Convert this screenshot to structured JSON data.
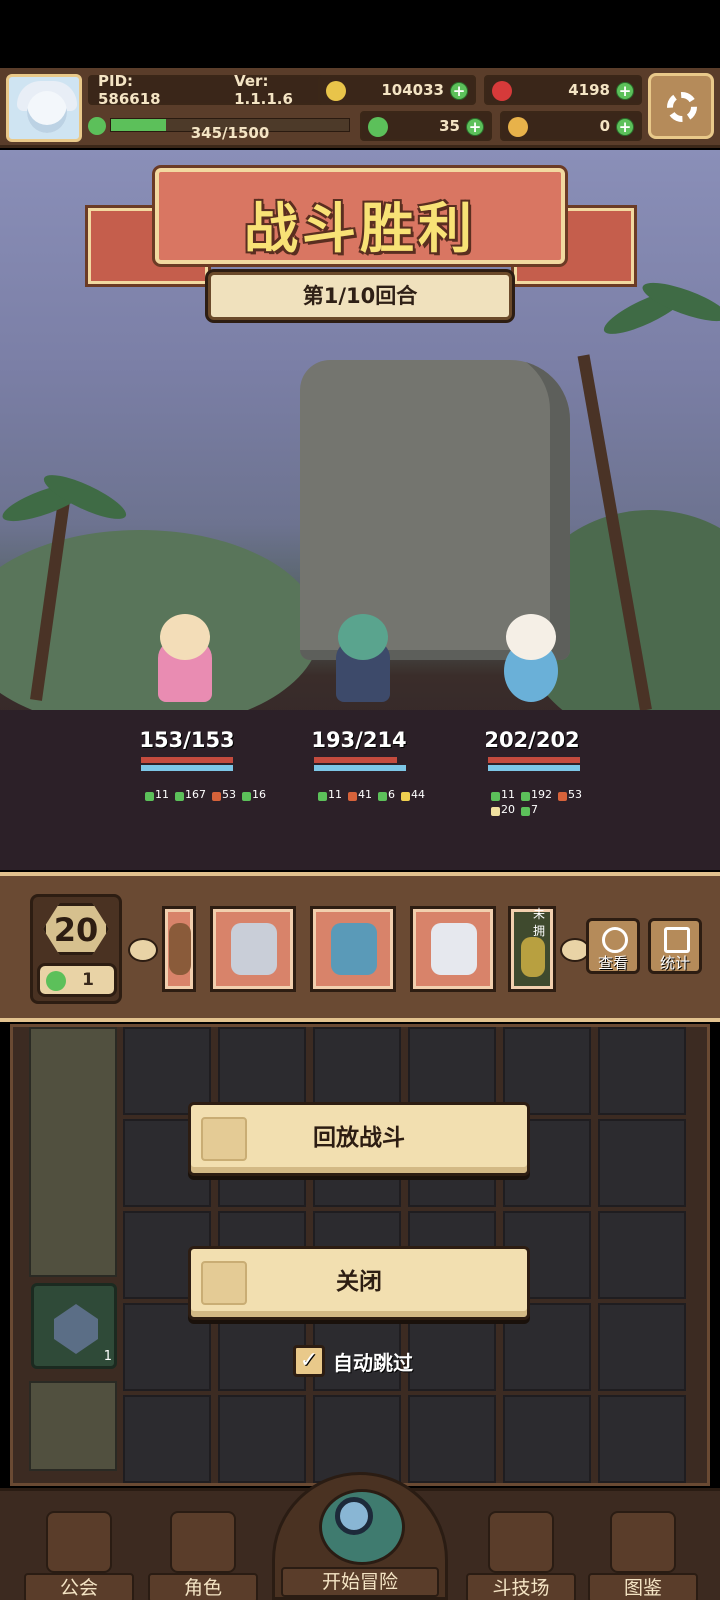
{
  "hud": {
    "pid": "PID: 586618",
    "version": "Ver: 1.1.1.6",
    "xp_text": "345/1500",
    "xp_fraction": 0.23,
    "gold": "104033",
    "gems": "4198",
    "clover": "35",
    "keys": "0",
    "colors": {
      "gold": "#e8c44a",
      "gem": "#d63a3a",
      "clover": "#5cc05a",
      "key": "#e8b24a"
    }
  },
  "battle": {
    "title": "战斗胜利",
    "round": "第1/10回合",
    "heroes": [
      {
        "hp": "153/153",
        "hp_fraction": 1.0,
        "buffs": [
          "11",
          "167",
          "53",
          "16"
        ]
      },
      {
        "hp": "193/214",
        "hp_fraction": 0.9,
        "buffs": [
          "11",
          "41",
          "6",
          "44"
        ]
      },
      {
        "hp": "202/202",
        "hp_fraction": 1.0,
        "buffs": [
          "11",
          "192",
          "53",
          "20",
          "7"
        ]
      }
    ]
  },
  "strip": {
    "level": "20",
    "clover_count": "1",
    "items": [
      {
        "icon": "armor-icon",
        "color": "#8a5b3a"
      },
      {
        "icon": "helmet-icon",
        "color": "#c9ced8"
      },
      {
        "icon": "crystal-armor-icon",
        "color": "#5a9ab8"
      },
      {
        "icon": "gauntlet-icon",
        "color": "#e6e8ee"
      },
      {
        "icon": "statue-icon",
        "color": "#b8a040",
        "label": "未拥"
      }
    ],
    "view_label": "查看",
    "stats_label": "统计"
  },
  "board": {
    "gem_count": "1"
  },
  "dialog": {
    "replay_label": "回放战斗",
    "close_label": "关闭",
    "auto_skip_label": "自动跳过",
    "auto_skip_checked": "✓"
  },
  "nav": {
    "guild": "公会",
    "character": "角色",
    "start": "开始冒险",
    "arena": "斗技场",
    "codex": "图鉴"
  }
}
